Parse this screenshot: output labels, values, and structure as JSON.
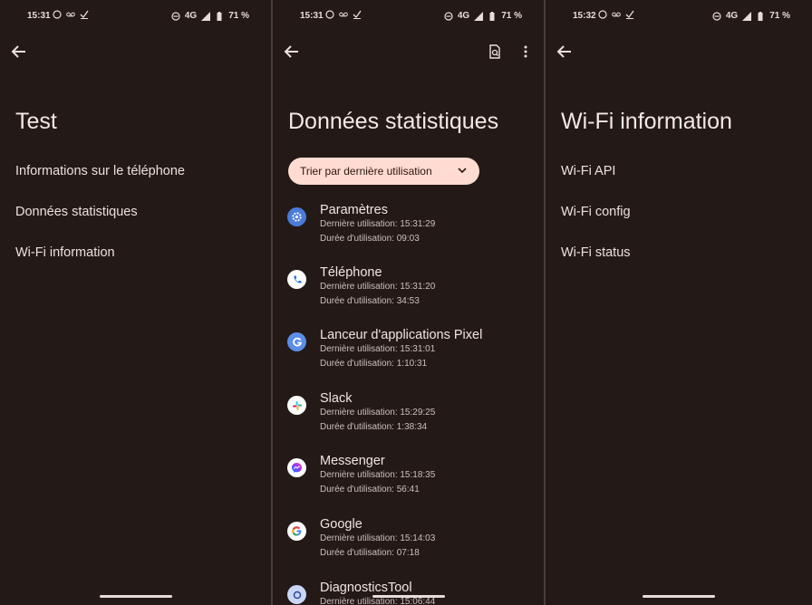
{
  "status_bars": [
    {
      "time": "15:31",
      "network": "4G",
      "battery": "71 %"
    },
    {
      "time": "15:31",
      "network": "4G",
      "battery": "71 %"
    },
    {
      "time": "15:32",
      "network": "4G",
      "battery": "71 %"
    }
  ],
  "screen1": {
    "title": "Test",
    "items": [
      "Informations sur le téléphone",
      "Données statistiques",
      "Wi-Fi information"
    ]
  },
  "screen2": {
    "title": "Données statistiques",
    "sort_label": "Trier par dernière utilisation",
    "apps": [
      {
        "name": "Paramètres",
        "last": "Dernière utilisation: 15:31:29",
        "duration": "Durée d'utilisation: 09:03",
        "icon": "settings-icon"
      },
      {
        "name": "Téléphone",
        "last": "Dernière utilisation: 15:31:20",
        "duration": "Durée d'utilisation: 34:53",
        "icon": "phone-icon"
      },
      {
        "name": "Lanceur d'applications Pixel",
        "last": "Dernière utilisation: 15:31:01",
        "duration": "Durée d'utilisation: 1:10:31",
        "icon": "pixel-launcher-icon"
      },
      {
        "name": "Slack",
        "last": "Dernière utilisation: 15:29:25",
        "duration": "Durée d'utilisation: 1:38:34",
        "icon": "slack-icon"
      },
      {
        "name": "Messenger",
        "last": "Dernière utilisation: 15:18:35",
        "duration": "Durée d'utilisation: 56:41",
        "icon": "messenger-icon"
      },
      {
        "name": "Google",
        "last": "Dernière utilisation: 15:14:03",
        "duration": "Durée d'utilisation: 07:18",
        "icon": "google-icon"
      },
      {
        "name": "DiagnosticsTool",
        "last": "Dernière utilisation: 15:06:44",
        "duration": "",
        "icon": "diagnostics-icon"
      }
    ]
  },
  "screen3": {
    "title": "Wi-Fi information",
    "items": [
      "Wi-Fi API",
      "Wi-Fi config",
      "Wi-Fi status"
    ]
  },
  "colors": {
    "background": "#231a17",
    "chip": "#ffdbd1",
    "text": "#ece0dc"
  }
}
